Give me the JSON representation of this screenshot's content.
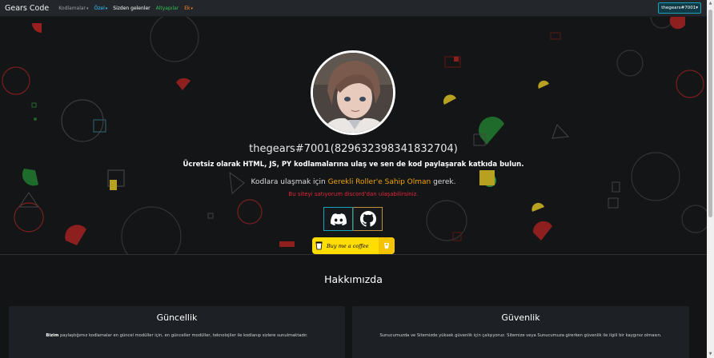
{
  "navbar": {
    "brand": "Gears Code",
    "items": [
      {
        "label": "Kodlamalar",
        "caret": "▾",
        "color": "#9aa0a6"
      },
      {
        "label": "Özel",
        "caret": "▾",
        "color": "#36c6ff"
      },
      {
        "label": "Sizden gelenler",
        "caret": "",
        "color": "#ffffff"
      },
      {
        "label": "Altyapılar",
        "caret": "",
        "color": "#2fbf54"
      },
      {
        "label": "Ek",
        "caret": "▾",
        "color": "#ff8a1e"
      }
    ],
    "user_button": "thegears#7001▾"
  },
  "hero": {
    "username": "thegears#7001(829632398341832704)",
    "tagline": "Ücretsiz olarak HTML, JS, PY kodlamalarına ulaş ve sen de kod paylaşarak katkıda bulun.",
    "access_prefix": "Kodlara ulaşmak için ",
    "access_highlight": "Gerekli Roller'e Sahip Olman",
    "access_suffix": " gerek.",
    "sale_notice": "Bu siteyi satıyorum discord'dan ulaşabilirsiniz.",
    "social": [
      {
        "icon": "discord-icon",
        "label": "Discord"
      },
      {
        "icon": "github-icon",
        "label": "GitHub"
      }
    ],
    "coffee_label": "Buy me a coffee"
  },
  "about": {
    "title": "Hakkımızda",
    "cards": [
      {
        "title": "Güncellik",
        "text_bold": "Bizim",
        "text": " paylaştığımız kodlamalar en güncel modüller için, en günceller modüller, teknolojiler ile kodlanıp sizlere sunulmaktadır."
      },
      {
        "title": "Güvenlik",
        "text_bold": "",
        "text": "Sunucumuzda ve Sitemizde yüksek güvenlik için çalışıyoruz. Sitemize veya Sunucumuza girerken güvenlik ile ilgili bir kaygınız olmasın."
      }
    ]
  },
  "colors": {
    "accent_cyan": "#17a2b8",
    "highlight_orange": "#f0a500",
    "alert_red": "#e0283a",
    "coffee_yellow": "#ffdd00"
  }
}
